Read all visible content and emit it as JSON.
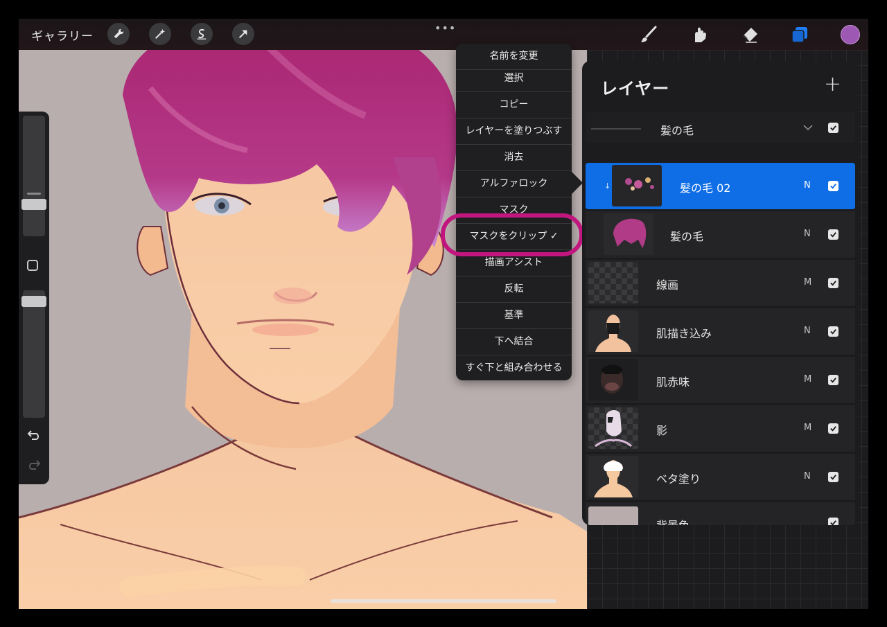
{
  "topbar": {
    "gallery_label": "ギャラリー",
    "tools_left": [
      "wrench-icon",
      "magic-wand-icon",
      "selection-s-icon",
      "transform-arrow-icon"
    ],
    "more_dots": "•••",
    "tools_right": [
      "brush-icon",
      "smudge-icon",
      "eraser-icon",
      "layers-icon"
    ],
    "current_color": "#9c58b3"
  },
  "menu": {
    "items": [
      "名前を変更",
      "選択",
      "コピー",
      "レイヤーを塗りつぶす",
      "消去",
      "アルファロック",
      "マスク",
      "マスクをクリップ ✓",
      "描画アシスト",
      "反転",
      "基準",
      "下へ結合",
      "すぐ下と組み合わせる"
    ],
    "highlighted_index": 7,
    "highlight_color": "#c2167f"
  },
  "layers_panel": {
    "title": "レイヤー",
    "add_label": "+",
    "group": {
      "name": "髪の毛"
    },
    "rows": [
      {
        "name": "髪の毛 02",
        "mode": "N",
        "active": true,
        "clipped": true
      },
      {
        "name": "髪の毛",
        "mode": "N"
      },
      {
        "name": "線画",
        "mode": "M"
      },
      {
        "name": "肌描き込み",
        "mode": "N"
      },
      {
        "name": "肌赤味",
        "mode": "M"
      },
      {
        "name": "影",
        "mode": "M"
      },
      {
        "name": "ベタ塗り",
        "mode": "N"
      },
      {
        "name": "背景色",
        "mode": ""
      }
    ],
    "accent": "#0f6ee6"
  }
}
